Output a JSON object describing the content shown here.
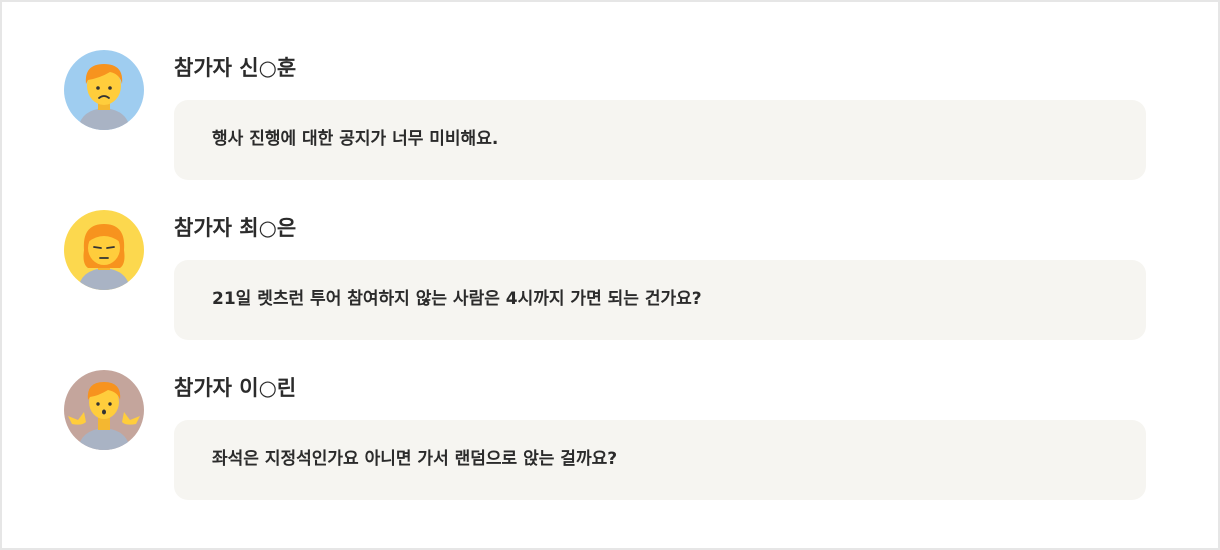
{
  "comments": [
    {
      "name": "참가자 신○훈",
      "message": "행사 진행에 대한 공지가 너무 미비해요.",
      "avatar_icon": "frowning-person-icon",
      "avatar_bg": "#9fcdf0"
    },
    {
      "name": "참가자 최○은",
      "message": "21일 렛츠런 투어 참여하지 않는 사람은 4시까지 가면 되는 건가요?",
      "avatar_icon": "annoyed-person-icon",
      "avatar_bg": "#fcd84e"
    },
    {
      "name": "참가자 이○린",
      "message": "좌석은 지정석인가요 아니면 가서 랜덤으로 앉는 걸까요?",
      "avatar_icon": "shrugging-person-icon",
      "avatar_bg": "#c4a59c"
    }
  ],
  "colors": {
    "hair": "#f7931e",
    "skin": "#ffcd3c",
    "shirt": "#a9b3c4",
    "bubble": "#f6f5f1",
    "text": "#2b2b2b"
  }
}
